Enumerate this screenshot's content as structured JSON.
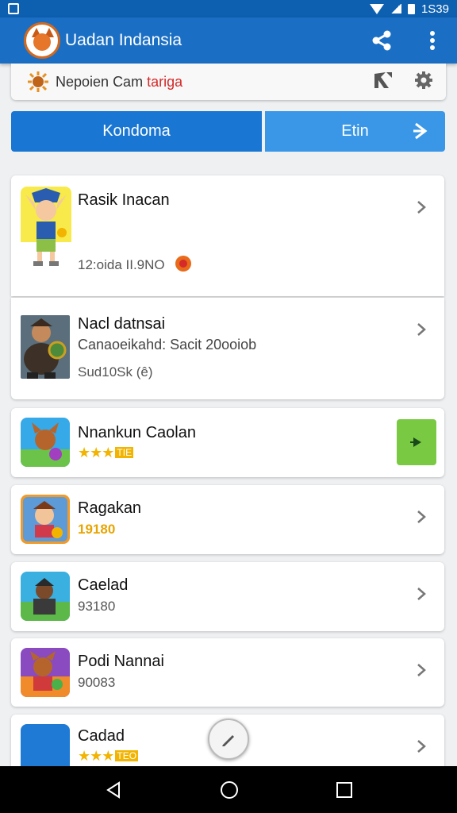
{
  "status_bar": {
    "time": "1S39"
  },
  "app_bar": {
    "title": "Uadan Indansia",
    "share_icon": "share-icon",
    "menu_icon": "more-vert-icon"
  },
  "summary": {
    "prefix": "Nepoien ",
    "middle": "Cam ",
    "highlight": "tariga"
  },
  "tabs": [
    {
      "label": "Kondoma"
    },
    {
      "label": "Etin"
    }
  ],
  "items": [
    {
      "title": "Rasik Inacan",
      "meta": "12:oida II.9NO"
    },
    {
      "title": "Nacl datnsai",
      "subtitle": "Canaoeikahd: Sacit 20ooiob",
      "meta": "Sud10Sk (ê)"
    },
    {
      "title": "Nnankun Caolan",
      "tag": "TIE"
    },
    {
      "title": "Ragakan",
      "meta": "19180"
    },
    {
      "title": "Caelad",
      "meta": "93180"
    },
    {
      "title": "Podi Nannai",
      "meta": "90083"
    },
    {
      "title": "Cadad",
      "tag": "TEO"
    }
  ],
  "colors": {
    "app_bar": "#1a6fc4",
    "tab_active": "#1976d2",
    "tab_secondary": "#3a97e8",
    "play_button": "#7ac943",
    "accent_gold": "#f2b400"
  }
}
